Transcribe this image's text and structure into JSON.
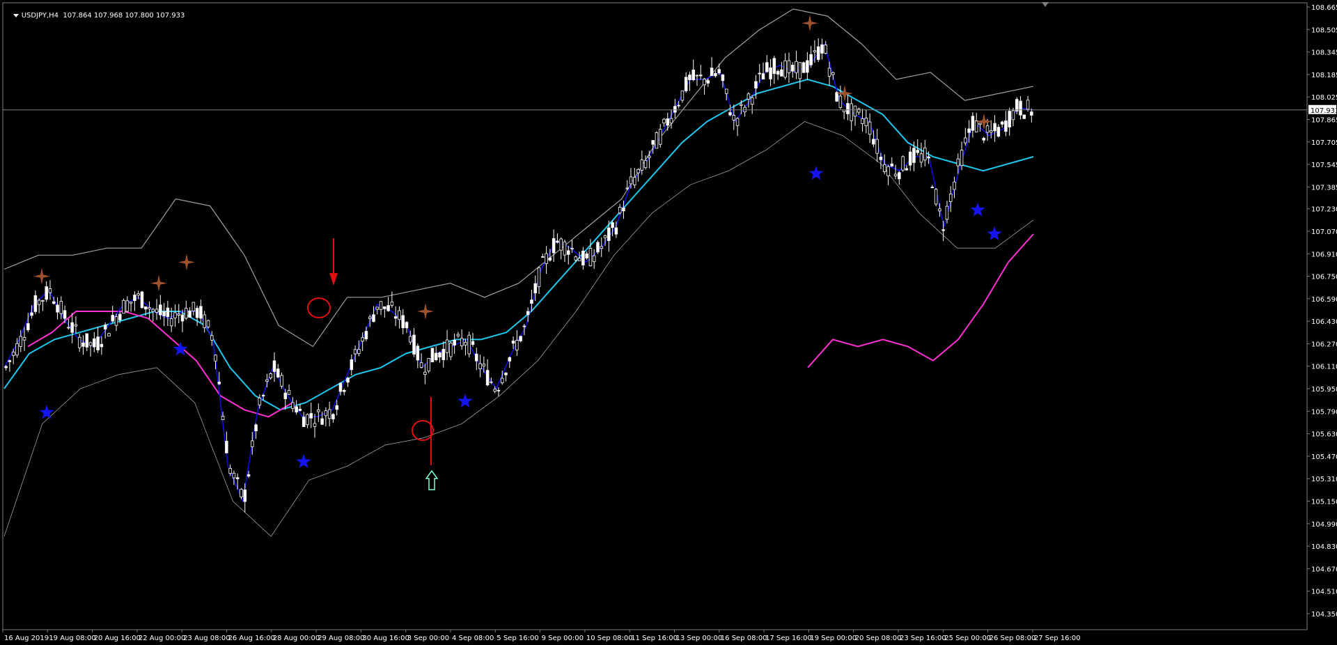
{
  "header": {
    "symbol": "USDJPY,H4",
    "ohlc": "107.864 107.968 107.800 107.933"
  },
  "price_axis": {
    "labels": [
      "108.665",
      "108.505",
      "108.345",
      "108.185",
      "108.025",
      "107.865",
      "107.705",
      "107.545",
      "107.385",
      "107.230",
      "107.070",
      "106.910",
      "106.750",
      "106.590",
      "106.430",
      "106.270",
      "106.110",
      "105.950",
      "105.790",
      "105.630",
      "105.470",
      "105.310",
      "105.150",
      "104.990",
      "104.830",
      "104.670",
      "104.510",
      "104.350"
    ],
    "current_price": "107.933"
  },
  "time_axis": {
    "labels": [
      "16 Aug 2019",
      "19 Aug 08:00",
      "20 Aug 16:00",
      "22 Aug 00:00",
      "23 Aug 08:00",
      "26 Aug 16:00",
      "28 Aug 00:00",
      "29 Aug 08:00",
      "30 Aug 16:00",
      "3 Sep 00:00",
      "4 Sep 08:00",
      "5 Sep 16:00",
      "9 Sep 00:00",
      "10 Sep 08:00",
      "11 Sep 16:00",
      "13 Sep 00:00",
      "16 Sep 08:00",
      "17 Sep 16:00",
      "19 Sep 00:00",
      "20 Sep 08:00",
      "23 Sep 16:00",
      "25 Sep 00:00",
      "26 Sep 08:00",
      "27 Sep 16:00"
    ]
  },
  "colors": {
    "background": "#000000",
    "candle_up": "#FFFFFF",
    "candle_down": "#000000",
    "bands": "#A0A0A0",
    "ma_slow": "#1EC8F0",
    "ma_fast": "#FF30D2",
    "ma_line": "#1010E0",
    "signal_sell": "#A0522D",
    "signal_buy": "#1414F0",
    "marker_red": "#E01010",
    "arrow_up": "#7FFFD4",
    "axis_text": "#FFFFFF",
    "current_line": "#808080"
  },
  "chart_data": {
    "type": "candlestick",
    "symbol": "USDJPY",
    "timeframe": "H4",
    "y_range": [
      104.35,
      108.665
    ],
    "last_price": 107.933,
    "x_labels": [
      "16 Aug 2019",
      "19 Aug 08:00",
      "20 Aug 16:00",
      "22 Aug 00:00",
      "23 Aug 08:00",
      "26 Aug 16:00",
      "28 Aug 00:00",
      "29 Aug 08:00",
      "30 Aug 16:00",
      "3 Sep 00:00",
      "4 Sep 08:00",
      "5 Sep 16:00",
      "9 Sep 00:00",
      "10 Sep 08:00",
      "11 Sep 16:00",
      "13 Sep 00:00",
      "16 Sep 08:00",
      "17 Sep 16:00",
      "19 Sep 00:00",
      "20 Sep 08:00",
      "23 Sep 16:00",
      "25 Sep 00:00",
      "26 Sep 08:00",
      "27 Sep 16:00"
    ],
    "close_path": [
      106.1,
      106.3,
      106.55,
      106.65,
      106.45,
      106.3,
      106.25,
      106.4,
      106.55,
      106.6,
      106.5,
      106.45,
      106.5,
      106.5,
      106.3,
      105.4,
      105.15,
      105.8,
      106.1,
      105.9,
      105.75,
      105.75,
      105.8,
      106.05,
      106.3,
      106.55,
      106.5,
      106.4,
      106.1,
      106.2,
      106.25,
      106.3,
      106.1,
      105.95,
      106.2,
      106.4,
      106.8,
      107.0,
      106.95,
      106.85,
      106.95,
      107.1,
      107.4,
      107.55,
      107.75,
      107.95,
      108.15,
      108.15,
      108.2,
      107.85,
      108.0,
      108.2,
      108.25,
      108.2,
      108.25,
      108.4,
      108.0,
      107.9,
      107.85,
      107.55,
      107.5,
      107.6,
      107.6,
      107.1,
      107.5,
      107.85,
      107.75,
      107.8,
      107.95,
      107.93
    ],
    "ma_slow": [
      105.95,
      106.2,
      106.3,
      106.35,
      106.4,
      106.45,
      106.5,
      106.5,
      106.4,
      106.1,
      105.9,
      105.8,
      105.85,
      105.95,
      106.05,
      106.1,
      106.2,
      106.25,
      106.3,
      106.3,
      106.35,
      106.5,
      106.7,
      106.9,
      107.1,
      107.3,
      107.5,
      107.7,
      107.85,
      107.95,
      108.05,
      108.1,
      108.15,
      108.1,
      108.0,
      107.9,
      107.7,
      107.6,
      107.55,
      107.5,
      107.55,
      107.6
    ],
    "ma_fast": [
      106.25,
      106.35,
      106.5,
      106.5,
      106.5,
      106.45,
      106.3,
      106.15,
      105.9,
      105.8,
      105.75,
      105.85,
      106.1,
      106.3,
      106.25,
      106.3,
      106.25,
      106.15,
      106.3,
      106.55,
      106.85,
      107.05
    ],
    "bands_upper": [
      106.8,
      106.9,
      106.9,
      106.95,
      106.95,
      107.3,
      107.25,
      106.9,
      106.4,
      106.25,
      106.6,
      106.6,
      106.65,
      106.7,
      106.6,
      106.7,
      106.9,
      107.1,
      107.3,
      107.7,
      108.0,
      108.3,
      108.5,
      108.65,
      108.6,
      108.4,
      108.15,
      108.2,
      108.0,
      108.05,
      108.1
    ],
    "bands_lower": [
      104.9,
      105.7,
      105.95,
      106.05,
      106.1,
      105.85,
      105.15,
      104.9,
      105.3,
      105.4,
      105.55,
      105.6,
      105.7,
      105.9,
      106.15,
      106.5,
      106.9,
      107.2,
      107.4,
      107.5,
      107.65,
      107.85,
      107.75,
      107.55,
      107.2,
      106.95,
      106.95,
      107.15
    ],
    "sell_signals": [
      "19 Aug 08:00",
      "22 Aug 00:00",
      "23 Aug 08:00",
      "3 Sep 00:00",
      "19 Sep 00:00",
      "20 Sep 08:00",
      "26 Sep 08:00"
    ],
    "buy_signals": [
      "16 Aug 2019",
      "23 Aug 08:00",
      "28 Aug 00:00",
      "4 Sep 08:00",
      "19 Sep 00:00",
      "25 Sep 00:00",
      "26 Sep 08:00"
    ]
  }
}
